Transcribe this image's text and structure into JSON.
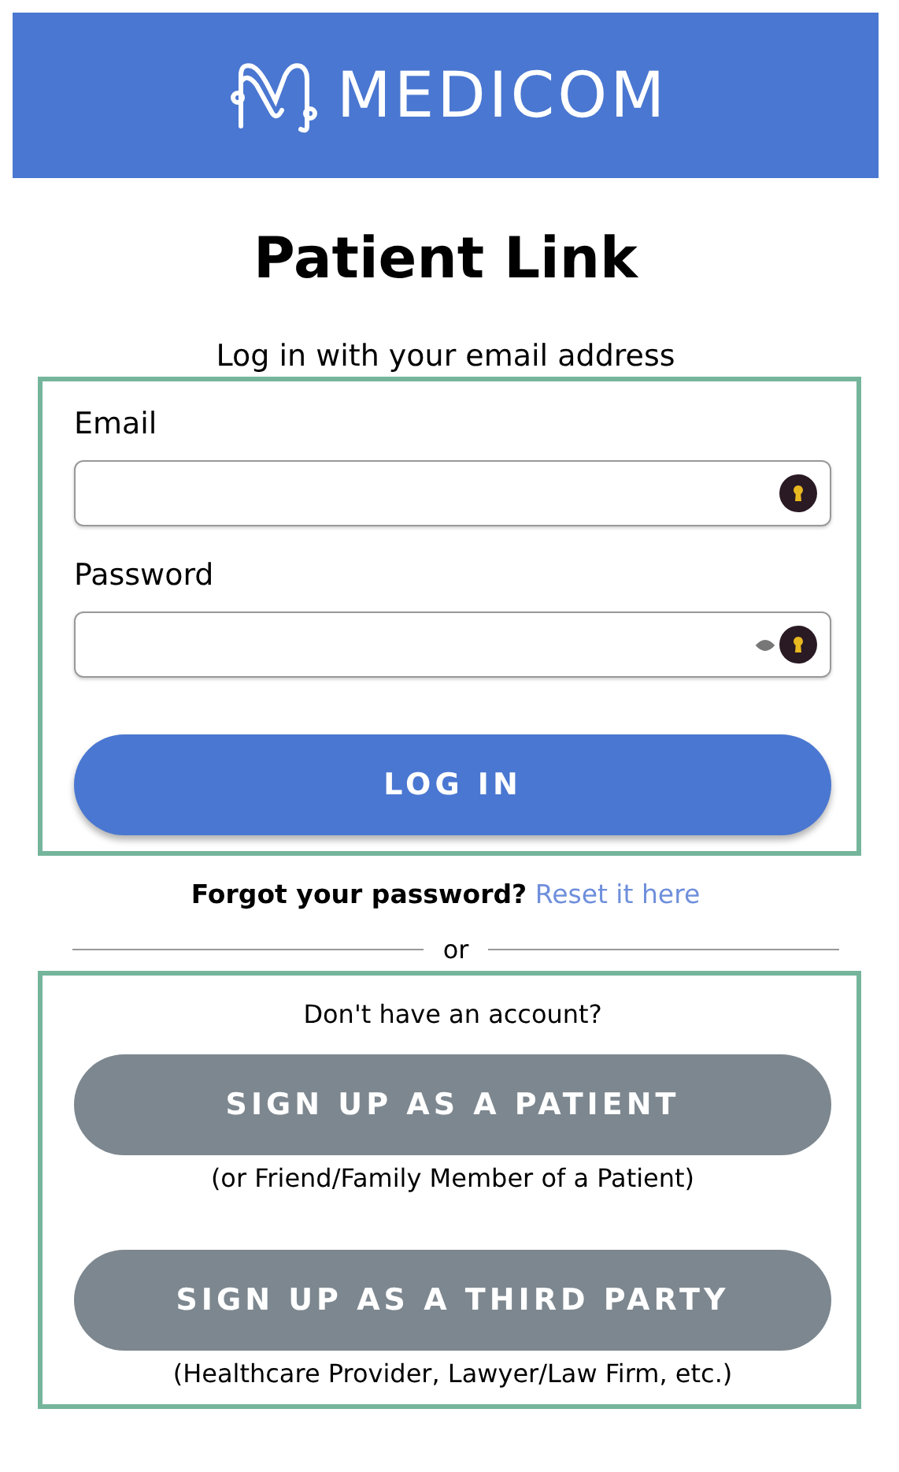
{
  "header": {
    "brand": "MEDICOM"
  },
  "title": "Patient Link",
  "subtitle": "Log in with your email address",
  "fields": [
    {
      "label": "Email",
      "kind": "email"
    },
    {
      "label": "Password",
      "kind": "password"
    }
  ],
  "login_button": "LOG IN",
  "forgot": {
    "text": "Forgot your password?",
    "link": "Reset it here"
  },
  "divider": "or",
  "signup": {
    "prompt": "Don't have an account?",
    "options": [
      {
        "button": "SIGN UP AS A PATIENT",
        "note": "(or Friend/Family Member of a Patient)"
      },
      {
        "button": "SIGN UP AS A THIRD PARTY",
        "note": "(Healthcare Provider, Lawyer/Law Firm, etc.)"
      }
    ]
  }
}
